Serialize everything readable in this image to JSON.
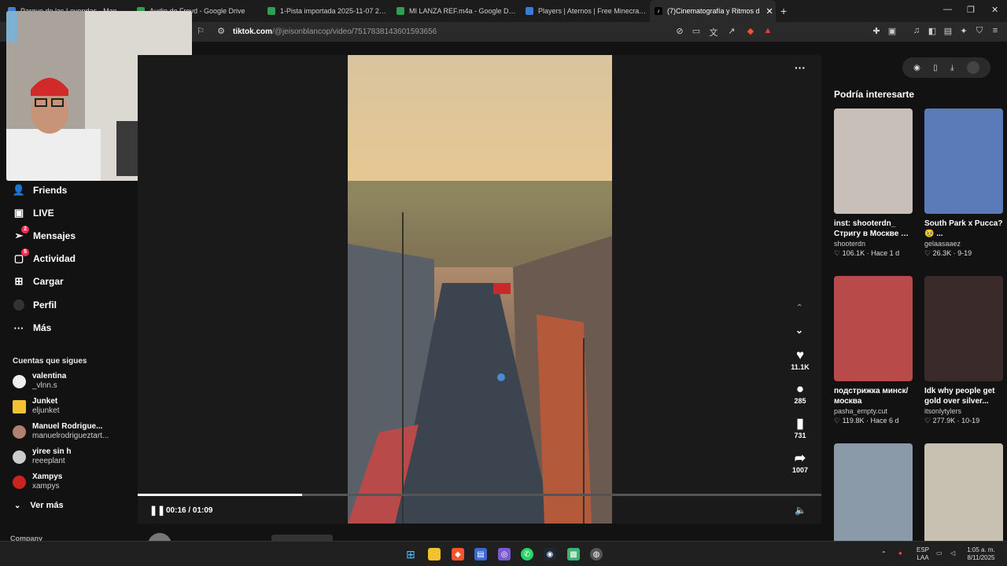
{
  "browser": {
    "tabs": [
      {
        "label": "Parque de las Leyendas - Manual seg",
        "icon": "doc-icon",
        "color": "#4a7cd4"
      },
      {
        "label": "Audio de Froyd - Google Drive",
        "icon": "drive-icon",
        "color": "#2f9e4f"
      },
      {
        "label": "1-Pista importada 2025-11-07 20_28",
        "icon": "drive-icon",
        "color": "#2f9e4f"
      },
      {
        "label": "MI LANZA REF.m4a - Google Drive",
        "icon": "drive-icon",
        "color": "#2f9e4f"
      },
      {
        "label": "Players | Aternos | Free Minecraft Ser",
        "icon": "aternos-icon",
        "color": "#3a7bd5"
      },
      {
        "label": "(7)Cinematografía y Ritmos d",
        "icon": "tiktok-icon",
        "color": "#000000"
      }
    ],
    "url_host": "tiktok.com",
    "url_path": "/@jeisonblancop/video/7517838143601593656"
  },
  "sidebar": {
    "items": [
      {
        "label": "Friends",
        "icon": "friends-icon",
        "glyph": "👤"
      },
      {
        "label": "LIVE",
        "icon": "live-icon",
        "glyph": "📺"
      },
      {
        "label": "Mensajes",
        "icon": "messages-icon",
        "glyph": "✈",
        "badge": "2"
      },
      {
        "label": "Actividad",
        "icon": "activity-icon",
        "glyph": "💬",
        "badge": "5"
      },
      {
        "label": "Cargar",
        "icon": "upload-icon",
        "glyph": "+"
      },
      {
        "label": "Perfil",
        "icon": "profile-icon",
        "glyph": ""
      },
      {
        "label": "Más",
        "icon": "more-icon",
        "glyph": "···"
      }
    ],
    "following_header": "Cuentas que sigues",
    "following": [
      {
        "name": "valentina",
        "handle": "_vlnn.s",
        "color": "#eeeeee"
      },
      {
        "name": "Junket",
        "handle": "eljunket",
        "color": "#f2c230"
      },
      {
        "name": "Manuel Rodrigue...",
        "handle": "manuelrodrigueztart...",
        "color": "#b08070"
      },
      {
        "name": "yiree sin h",
        "handle": "reeeplant",
        "color": "#cccccc"
      },
      {
        "name": "Xampys",
        "handle": "xampys",
        "color": "#cc2222"
      }
    ],
    "see_more": "Ver más",
    "company": "Company"
  },
  "player": {
    "time": "00:16 / 01:09",
    "progress_fraction": 0.24,
    "actions": [
      {
        "icon": "heart-icon",
        "glyph": "♥",
        "count": "11.1K"
      },
      {
        "icon": "comment-icon",
        "glyph": "💬",
        "count": "285"
      },
      {
        "icon": "bookmark-icon",
        "glyph": "🔖",
        "count": "731"
      },
      {
        "icon": "share-icon",
        "glyph": "➦",
        "count": "1007"
      }
    ],
    "author": "jeisonblancop"
  },
  "recommended": {
    "title": "Podría interesarte",
    "cards": [
      {
        "line1": "inst: shooterdn_",
        "line2": "Стригу в Москве и ...",
        "author": "shooterdn",
        "likes": "106.1K",
        "date": "Hace 1 d",
        "bg": "#c8c0b8"
      },
      {
        "line1": "South Park x Pucca?",
        "line2": "🥹 ...",
        "author": "gelaasaaez",
        "likes": "26.3K",
        "date": "9-19",
        "bg": "#5a7ab8"
      },
      {
        "line1": "подстрижка минск/",
        "line2": "москва",
        "author": "pasha_empty.cut",
        "likes": "119.8K",
        "date": "Hace 6 d",
        "bg": "#b84a4a"
      },
      {
        "line1": "Idk why people get",
        "line2": "gold over silver...",
        "author": "itsonlytylers",
        "likes": "277.9K",
        "date": "10-19",
        "bg": "#3a2a2a"
      },
      {
        "line1": "",
        "line2": "",
        "author": "",
        "likes": "",
        "date": "",
        "bg": "#8a9aa8"
      },
      {
        "line1": "",
        "line2": "",
        "author": "",
        "likes": "",
        "date": "",
        "bg": "#c8c0b0"
      }
    ]
  },
  "taskbar": {
    "lang": "ESP",
    "region": "LAA",
    "time": "1:05 a. m.",
    "date": "8/11/2025"
  }
}
